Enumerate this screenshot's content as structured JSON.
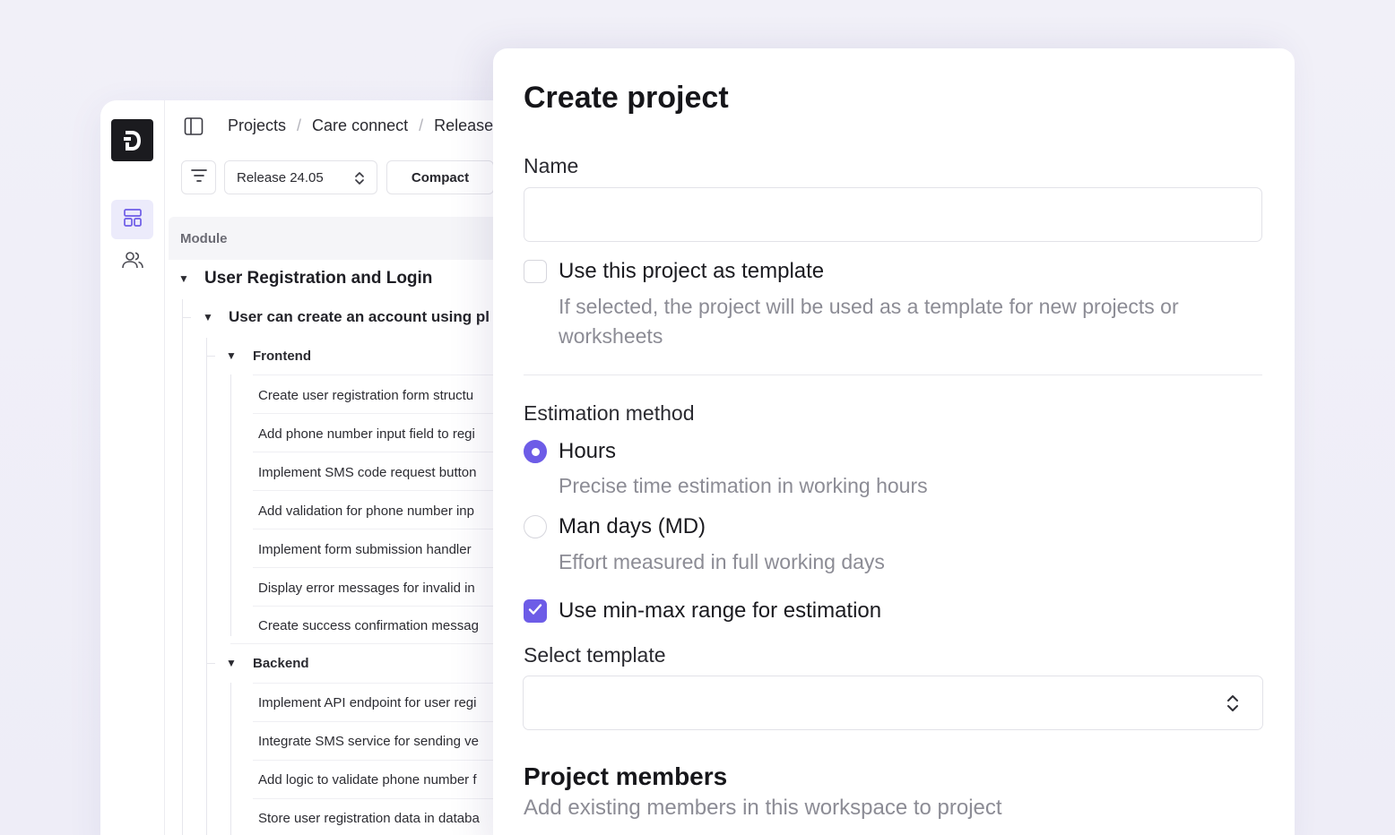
{
  "app": {
    "breadcrumbs": [
      "Projects",
      "Care connect",
      "Release"
    ],
    "breadcrumb_separator": "/",
    "release_select": {
      "value": "Release 24.05"
    },
    "view_mode_label": "Compact",
    "table_header": "Module",
    "tree": {
      "module": "User Registration and Login",
      "story": "User can create an account using pl",
      "groups": [
        {
          "label": "Frontend",
          "tasks": [
            "Create user registration form structu",
            "Add phone number input field to regi",
            "Implement SMS code request button",
            "Add validation for phone number inp",
            "Implement form submission handler",
            "Display error messages for invalid in",
            "Create success confirmation messag"
          ]
        },
        {
          "label": "Backend",
          "tasks": [
            "Implement API endpoint for user regi",
            "Integrate SMS service for sending ve",
            "Add logic to validate phone number f",
            "Store user registration data in databa"
          ]
        }
      ]
    },
    "icons": {
      "logo": "brand-logo-icon",
      "nav_board": "layout-board-icon",
      "nav_members": "users-icon",
      "sidebar_toggle": "sidebar-toggle-icon",
      "filter": "filter-icon",
      "select_chevron": "chevron-up-down-icon",
      "expand": "triangle-down-icon"
    },
    "colors": {
      "accent": "#6d5ce7",
      "active_nav_bg": "#ecebfb"
    }
  },
  "modal": {
    "title": "Create project",
    "name_label": "Name",
    "name_value": "",
    "template_checkbox": {
      "label": "Use this project as template",
      "help": "If selected, the project will be used as a template for new projects or worksheets",
      "checked": false
    },
    "estimation": {
      "label": "Estimation method",
      "options": [
        {
          "label": "Hours",
          "help": "Precise time estimation in working hours",
          "selected": true
        },
        {
          "label": "Man days (MD)",
          "help": "Effort measured in full working days",
          "selected": false
        }
      ]
    },
    "range_checkbox": {
      "label": "Use min-max range for estimation",
      "checked": true
    },
    "select_template": {
      "label": "Select template",
      "value": ""
    },
    "members": {
      "title": "Project members",
      "subtitle": "Add existing members in this workspace to project"
    }
  }
}
